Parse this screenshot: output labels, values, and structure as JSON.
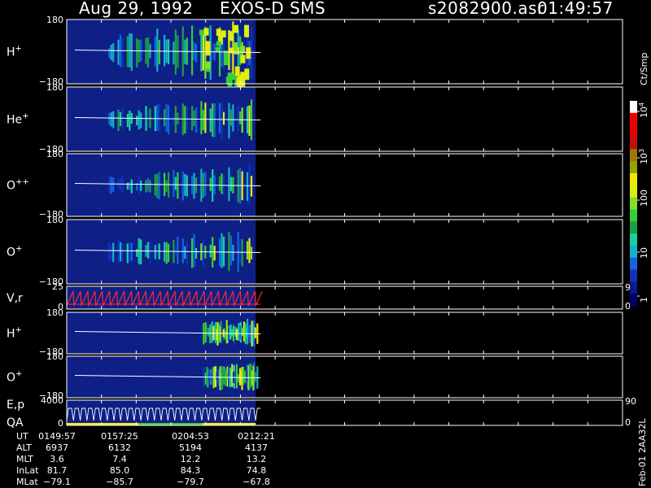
{
  "header": {
    "date": "Aug 29, 1992",
    "instrument": "EXOS-D SMS",
    "file": "s2082900.asr",
    "time": "01:49:57"
  },
  "colors": {
    "background": "#000000",
    "panel_fill": "#0e1f86",
    "frame": "#ffffff",
    "velocity_trace": "#ff2a2a",
    "qa_yellow": "#f4ee1c",
    "qa_green": "#3ccf3c"
  },
  "panels": [
    {
      "label": "H",
      "sup": "+",
      "ytop": "180",
      "ybot": "−180"
    },
    {
      "label": "He",
      "sup": "+",
      "ytop": "180",
      "ybot": "−180"
    },
    {
      "label": "O",
      "sup": "++",
      "ytop": "180",
      "ybot": "−180"
    },
    {
      "label": "O",
      "sup": "+",
      "ytop": "180",
      "ybot": "−180"
    },
    {
      "label": "V,r",
      "sup": "",
      "ytop": "25",
      "ybot": "0",
      "rtop": "90",
      "rbot": "0"
    },
    {
      "label": "H",
      "sup": "+",
      "ytop": "180",
      "ybot": "−180"
    },
    {
      "label": "O",
      "sup": "+",
      "ytop": "180",
      "ybot": "−180"
    },
    {
      "label": "E,p",
      "label2": "QA",
      "sup": "",
      "ytop": "4000",
      "ybot": "0",
      "rtop": "90",
      "rbot": "0"
    }
  ],
  "colorbar": {
    "unit": "Ct/Smp",
    "ticks": [
      {
        "base": "10",
        "exp": "4"
      },
      {
        "base": "10",
        "exp": "3"
      },
      {
        "base": "100",
        "exp": ""
      },
      {
        "base": "10",
        "exp": ""
      },
      {
        "base": "1",
        "exp": ""
      }
    ],
    "colors": [
      "#00006a",
      "#0b1a8c",
      "#1033b8",
      "#1166e0",
      "#14b0c8",
      "#18d0a0",
      "#1ea040",
      "#34d034",
      "#84e028",
      "#d8f010",
      "#f0e800",
      "#9aa000",
      "#a07800",
      "#c01010",
      "#e80000",
      "#f00000",
      "#ffffff"
    ]
  },
  "footer": {
    "side_label": "Feb-01 2AA32L",
    "row_labels": [
      "UT",
      "ALT",
      "MLT",
      "InLat",
      "MLat"
    ],
    "columns": [
      {
        "UT": "0149:57",
        "ALT": "6937",
        "MLT": "3.6",
        "InLat": "81.7",
        "MLat": "−79.1"
      },
      {
        "UT": "0157:25",
        "ALT": "6132",
        "MLT": "7.4",
        "InLat": "85.0",
        "MLat": "−85.7"
      },
      {
        "UT": "0204:53",
        "ALT": "5194",
        "MLT": "12.2",
        "InLat": "84.3",
        "MLat": "−79.7"
      },
      {
        "UT": "0212:21",
        "ALT": "4137",
        "MLT": "13.2",
        "InLat": "74.8",
        "MLat": "−67.8"
      }
    ]
  },
  "chart_data": {
    "type": "heatmap",
    "title": "Aug 29, 1992   EXOS-D SMS",
    "x_tick_labels": [
      "0149:57",
      "0157:25",
      "0204:53",
      "0212:21"
    ],
    "data_coverage_fraction": 0.34,
    "ion_panels": [
      "H+",
      "He+",
      "O++",
      "O+",
      "H+",
      "O+"
    ],
    "ion_panel_ylim": [
      -180,
      180
    ],
    "velocity_panel": {
      "label": "V,r",
      "ylim": [
        0,
        25
      ],
      "right_ylim": [
        0,
        90
      ]
    },
    "energy_panel": {
      "label": "E,p",
      "ylim": [
        0,
        4000
      ],
      "right_ylim": [
        0,
        90
      ]
    },
    "colorbar": {
      "unit": "Ct/Smp",
      "scale": "log",
      "range": [
        1,
        10000
      ]
    }
  }
}
